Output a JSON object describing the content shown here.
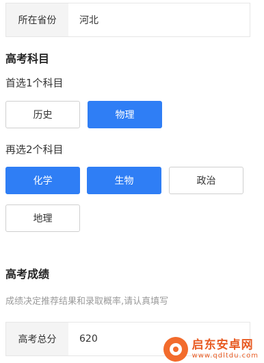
{
  "province": {
    "label": "所在省份",
    "value": "河北"
  },
  "subjects": {
    "title": "高考科目",
    "first_prompt": "首选1个科目",
    "first_options": [
      {
        "label": "历史",
        "selected": false
      },
      {
        "label": "物理",
        "selected": true
      }
    ],
    "second_prompt": "再选2个科目",
    "second_options": [
      {
        "label": "化学",
        "selected": true
      },
      {
        "label": "生物",
        "selected": true
      },
      {
        "label": "政治",
        "selected": false
      },
      {
        "label": "地理",
        "selected": false
      }
    ]
  },
  "score": {
    "title": "高考成绩",
    "hint": "成绩决定推荐结果和录取概率,请认真填写",
    "label": "高考总分",
    "value": "620"
  },
  "watermark": {
    "name": "启东安卓网",
    "url": "www.qdltdu.com"
  },
  "colors": {
    "accent": "#2f7ef5",
    "label_bg": "#f4f4f4",
    "hint": "#9a9a9a"
  }
}
